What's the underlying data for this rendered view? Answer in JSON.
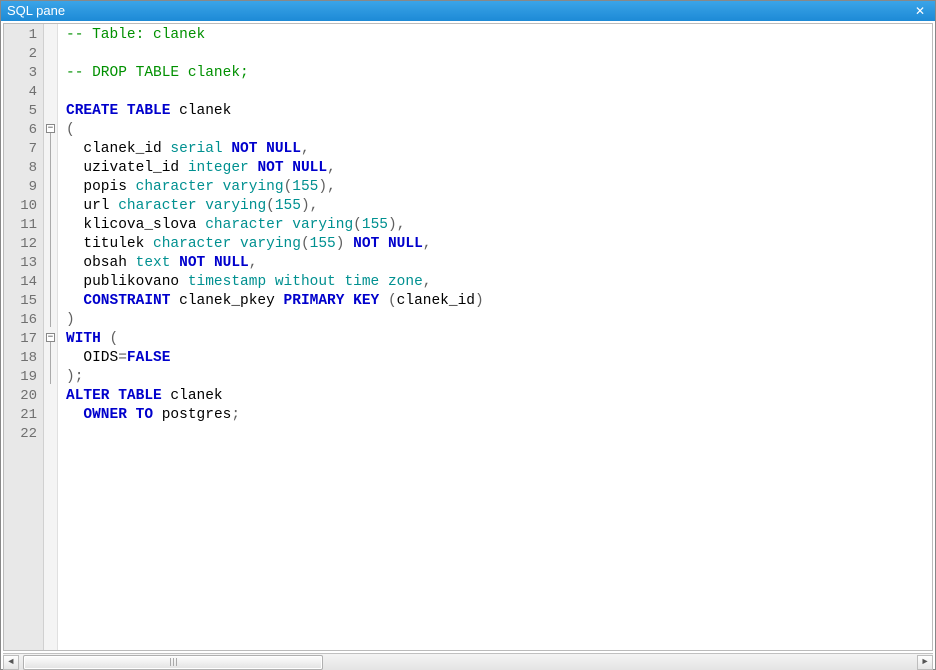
{
  "window": {
    "title": "SQL pane",
    "close_glyph": "✕"
  },
  "editor": {
    "line_count": 22,
    "fold_markers": {
      "6": "−",
      "17": "−"
    },
    "fold_ranges": [
      {
        "from": 6,
        "to": 16
      },
      {
        "from": 17,
        "to": 19
      }
    ],
    "lines": [
      {
        "n": 1,
        "tokens": [
          {
            "t": "-- Table: clanek",
            "c": "comment"
          }
        ]
      },
      {
        "n": 2,
        "tokens": [
          {
            "t": "",
            "c": "plain"
          }
        ]
      },
      {
        "n": 3,
        "tokens": [
          {
            "t": "-- DROP TABLE clanek;",
            "c": "comment"
          }
        ]
      },
      {
        "n": 4,
        "tokens": [
          {
            "t": "",
            "c": "plain"
          }
        ]
      },
      {
        "n": 5,
        "tokens": [
          {
            "t": "CREATE TABLE",
            "c": "keyword"
          },
          {
            "t": " clanek",
            "c": "ident"
          }
        ]
      },
      {
        "n": 6,
        "tokens": [
          {
            "t": "(",
            "c": "punct"
          }
        ]
      },
      {
        "n": 7,
        "tokens": [
          {
            "t": "  clanek_id ",
            "c": "ident"
          },
          {
            "t": "serial",
            "c": "type"
          },
          {
            "t": " ",
            "c": "plain"
          },
          {
            "t": "NOT NULL",
            "c": "keyword"
          },
          {
            "t": ",",
            "c": "punct"
          }
        ]
      },
      {
        "n": 8,
        "tokens": [
          {
            "t": "  uzivatel_id ",
            "c": "ident"
          },
          {
            "t": "integer",
            "c": "type"
          },
          {
            "t": " ",
            "c": "plain"
          },
          {
            "t": "NOT NULL",
            "c": "keyword"
          },
          {
            "t": ",",
            "c": "punct"
          }
        ]
      },
      {
        "n": 9,
        "tokens": [
          {
            "t": "  popis ",
            "c": "ident"
          },
          {
            "t": "character varying",
            "c": "type"
          },
          {
            "t": "(",
            "c": "punct"
          },
          {
            "t": "155",
            "c": "number"
          },
          {
            "t": ")",
            "c": "punct"
          },
          {
            "t": ",",
            "c": "punct"
          }
        ]
      },
      {
        "n": 10,
        "tokens": [
          {
            "t": "  url ",
            "c": "ident"
          },
          {
            "t": "character varying",
            "c": "type"
          },
          {
            "t": "(",
            "c": "punct"
          },
          {
            "t": "155",
            "c": "number"
          },
          {
            "t": ")",
            "c": "punct"
          },
          {
            "t": ",",
            "c": "punct"
          }
        ]
      },
      {
        "n": 11,
        "tokens": [
          {
            "t": "  klicova_slova ",
            "c": "ident"
          },
          {
            "t": "character varying",
            "c": "type"
          },
          {
            "t": "(",
            "c": "punct"
          },
          {
            "t": "155",
            "c": "number"
          },
          {
            "t": ")",
            "c": "punct"
          },
          {
            "t": ",",
            "c": "punct"
          }
        ]
      },
      {
        "n": 12,
        "tokens": [
          {
            "t": "  titulek ",
            "c": "ident"
          },
          {
            "t": "character varying",
            "c": "type"
          },
          {
            "t": "(",
            "c": "punct"
          },
          {
            "t": "155",
            "c": "number"
          },
          {
            "t": ")",
            "c": "punct"
          },
          {
            "t": " ",
            "c": "plain"
          },
          {
            "t": "NOT NULL",
            "c": "keyword"
          },
          {
            "t": ",",
            "c": "punct"
          }
        ]
      },
      {
        "n": 13,
        "tokens": [
          {
            "t": "  obsah ",
            "c": "ident"
          },
          {
            "t": "text",
            "c": "type"
          },
          {
            "t": " ",
            "c": "plain"
          },
          {
            "t": "NOT NULL",
            "c": "keyword"
          },
          {
            "t": ",",
            "c": "punct"
          }
        ]
      },
      {
        "n": 14,
        "tokens": [
          {
            "t": "  publikovano ",
            "c": "ident"
          },
          {
            "t": "timestamp without time zone",
            "c": "type"
          },
          {
            "t": ",",
            "c": "punct"
          }
        ]
      },
      {
        "n": 15,
        "tokens": [
          {
            "t": "  ",
            "c": "plain"
          },
          {
            "t": "CONSTRAINT",
            "c": "keyword"
          },
          {
            "t": " clanek_pkey ",
            "c": "ident"
          },
          {
            "t": "PRIMARY KEY",
            "c": "keyword"
          },
          {
            "t": " (",
            "c": "punct"
          },
          {
            "t": "clanek_id",
            "c": "ident"
          },
          {
            "t": ")",
            "c": "punct"
          }
        ]
      },
      {
        "n": 16,
        "tokens": [
          {
            "t": ")",
            "c": "punct"
          }
        ]
      },
      {
        "n": 17,
        "tokens": [
          {
            "t": "WITH",
            "c": "keyword"
          },
          {
            "t": " (",
            "c": "punct"
          }
        ]
      },
      {
        "n": 18,
        "tokens": [
          {
            "t": "  OIDS",
            "c": "ident"
          },
          {
            "t": "=",
            "c": "punct"
          },
          {
            "t": "FALSE",
            "c": "keyword"
          }
        ]
      },
      {
        "n": 19,
        "tokens": [
          {
            "t": ");",
            "c": "punct"
          }
        ]
      },
      {
        "n": 20,
        "tokens": [
          {
            "t": "ALTER TABLE",
            "c": "keyword"
          },
          {
            "t": " clanek",
            "c": "ident"
          }
        ]
      },
      {
        "n": 21,
        "tokens": [
          {
            "t": "  ",
            "c": "plain"
          },
          {
            "t": "OWNER TO",
            "c": "keyword"
          },
          {
            "t": " postgres",
            "c": "ident"
          },
          {
            "t": ";",
            "c": "punct"
          }
        ]
      },
      {
        "n": 22,
        "tokens": [
          {
            "t": "",
            "c": "plain"
          }
        ]
      }
    ]
  },
  "scrollbar": {
    "left_arrow": "◄",
    "right_arrow": "►"
  }
}
